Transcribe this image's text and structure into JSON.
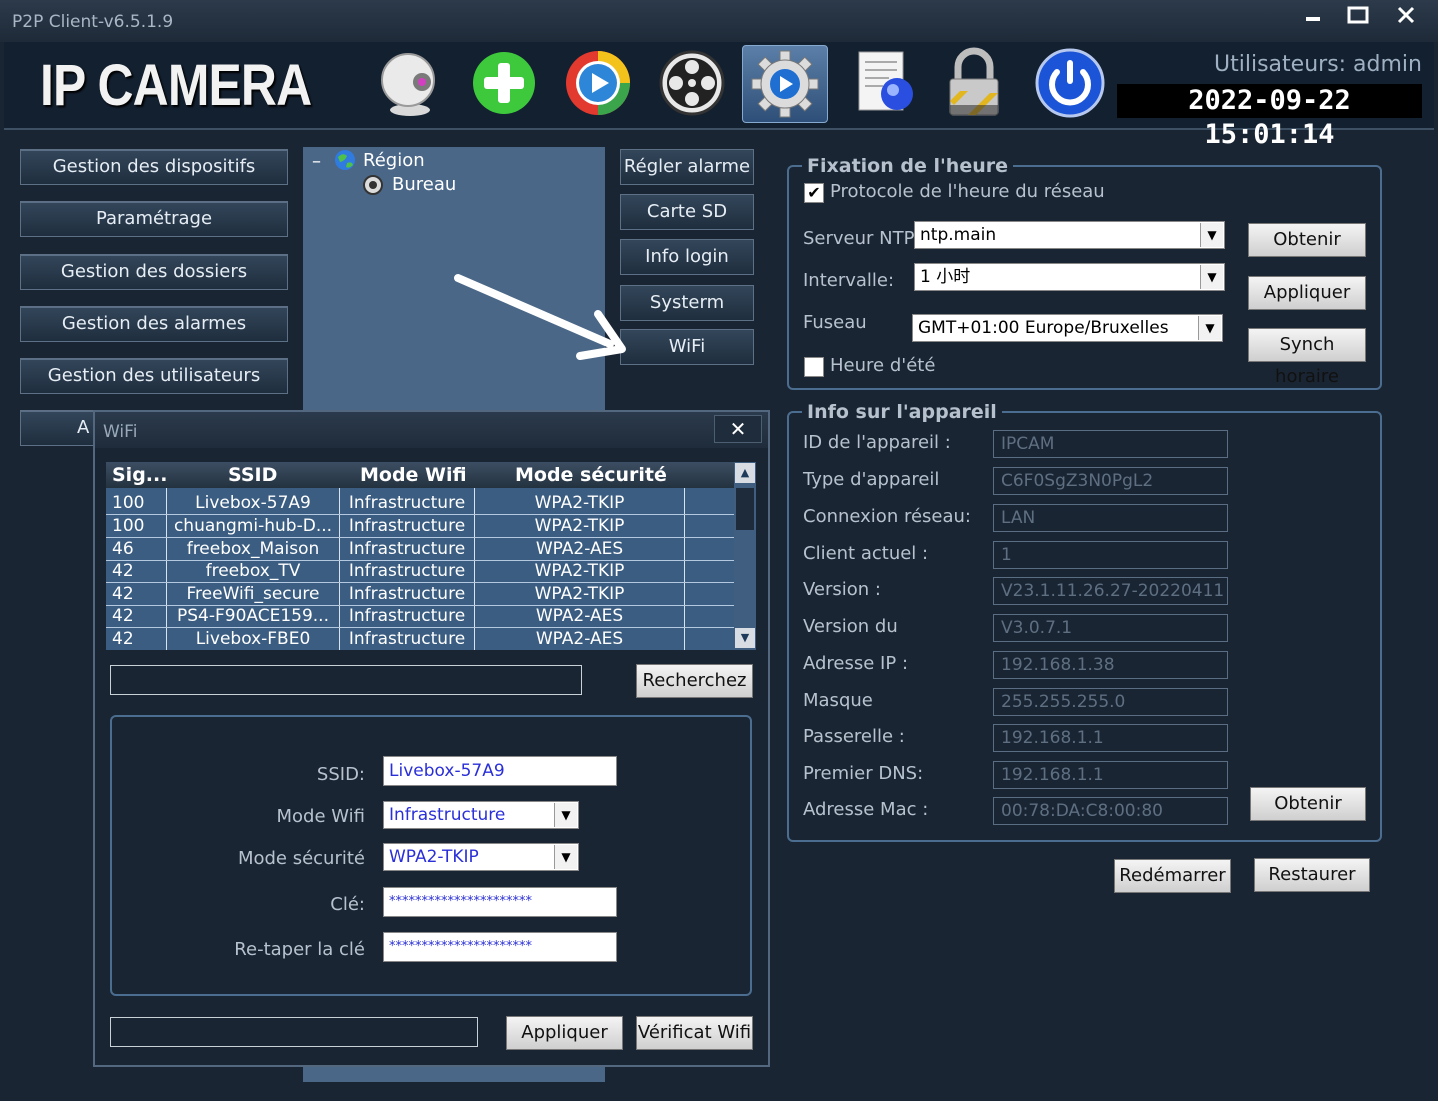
{
  "window": {
    "title": "P2P Client-v6.5.1.9"
  },
  "header": {
    "logo": "IP CAMERA",
    "user": "Utilisateurs: admin",
    "datetime": "2022-09-22 15:01:14"
  },
  "toolbar": [
    "camera-icon",
    "add-icon",
    "playback-icon",
    "film-reel-icon",
    "settings-icon",
    "log-icon",
    "lock-icon",
    "power-icon"
  ],
  "nav": {
    "items": [
      "Gestion des dispositifs",
      "Paramétrage",
      "Gestion des dossiers",
      "Gestion des alarmes",
      "Gestion des utilisateurs",
      "A"
    ]
  },
  "tree": {
    "root": "Région",
    "child": "Bureau",
    "collapse": "–"
  },
  "subnav": [
    "Régler alarme",
    "Carte SD",
    "Info login",
    "Systerm",
    "WiFi"
  ],
  "time": {
    "title": "Fixation de l'heure",
    "ntp_protocol_label": "Protocole de l'heure du réseau",
    "ntp_protocol_checked": true,
    "server_label": "Serveur NTP",
    "server_value": "ntp.main",
    "interval_label": "Intervalle:",
    "interval_value": "1 小时",
    "timezone_label": "Fuseau",
    "timezone_value": "GMT+01:00 Europe/Bruxelles",
    "dst_label": "Heure d'été",
    "dst_checked": false,
    "btn_get": "Obtenir",
    "btn_apply": "Appliquer",
    "btn_sync": "Synch horaire"
  },
  "device": {
    "title": "Info sur l'appareil",
    "fields": [
      {
        "label": "ID de l'appareil :",
        "value": "IPCAM"
      },
      {
        "label": "Type d'appareil",
        "value": "C6F0SgZ3N0PgL2"
      },
      {
        "label": "Connexion réseau:",
        "value": "LAN"
      },
      {
        "label": "Client actuel :",
        "value": "1"
      },
      {
        "label": "Version :",
        "value": "V23.1.11.26.27-20220411"
      },
      {
        "label": "Version du",
        "value": "V3.0.7.1"
      },
      {
        "label": "Adresse IP :",
        "value": "192.168.1.38"
      },
      {
        "label": "Masque",
        "value": "255.255.255.0"
      },
      {
        "label": "Passerelle :",
        "value": "192.168.1.1"
      },
      {
        "label": "Premier DNS:",
        "value": "192.168.1.1"
      },
      {
        "label": "Adresse Mac :",
        "value": "00:78:DA:C8:00:80"
      }
    ],
    "btn_get": "Obtenir",
    "btn_restart": "Redémarrer",
    "btn_restore": "Restaurer"
  },
  "wifi": {
    "title": "WiFi",
    "close": "✕",
    "columns": [
      "Sig...",
      "SSID",
      "Mode Wifi",
      "Mode sécurité"
    ],
    "rows": [
      [
        "100",
        "Livebox-57A9",
        "Infrastructure",
        "WPA2-TKIP"
      ],
      [
        "100",
        "chuangmi-hub-D...",
        "Infrastructure",
        "WPA2-TKIP"
      ],
      [
        "46",
        "freebox_Maison",
        "Infrastructure",
        "WPA2-AES"
      ],
      [
        "42",
        "freebox_TV",
        "Infrastructure",
        "WPA2-TKIP"
      ],
      [
        "42",
        "FreeWifi_secure",
        "Infrastructure",
        "WPA2-TKIP"
      ],
      [
        "42",
        "PS4-F90ACE159...",
        "Infrastructure",
        "WPA2-AES"
      ],
      [
        "42",
        "Livebox-FBE0",
        "Infrastructure",
        "WPA2-AES"
      ]
    ],
    "btn_search": "Recherchez",
    "ssid_label": "SSID:",
    "ssid_value": "Livebox-57A9",
    "mode_label": "Mode Wifi",
    "mode_value": "Infrastructure",
    "security_label": "Mode sécurité",
    "security_value": "WPA2-TKIP",
    "key_label": "Clé:",
    "key_value": "**********************",
    "rekey_label": "Re-taper la clé",
    "rekey_value": "**********************",
    "btn_apply": "Appliquer",
    "btn_check": "Vérificat Wifi"
  }
}
